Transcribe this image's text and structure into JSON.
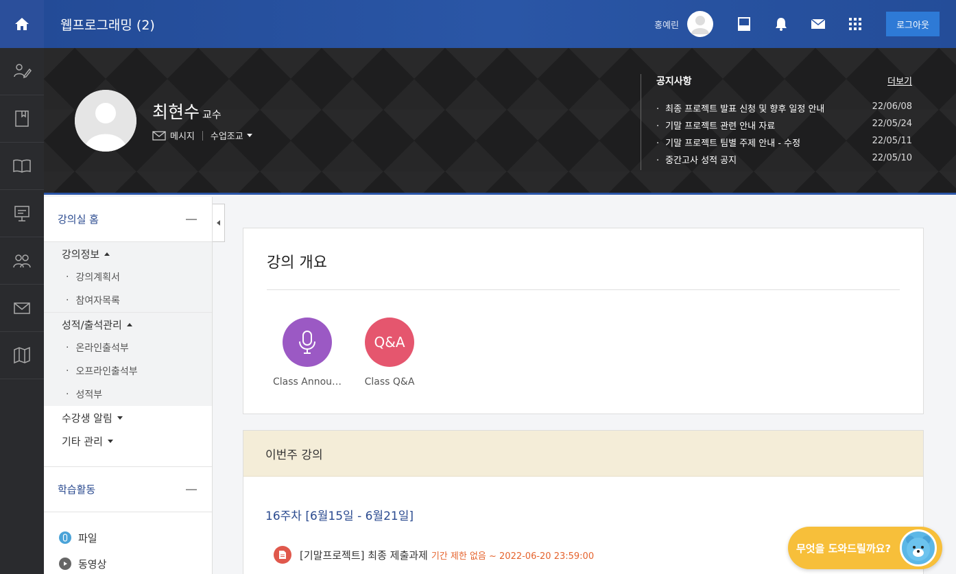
{
  "header": {
    "course_title": "웹프로그래밍 (2)",
    "user_name": "홍예린",
    "logout_label": "로그아웃"
  },
  "rail": {
    "icons": [
      "home-icon",
      "pencil-person-icon",
      "bookmark-book-icon",
      "open-book-icon",
      "presentation-board-icon",
      "people-icon",
      "mail-icon",
      "map-icon"
    ]
  },
  "profile": {
    "name": "최현수",
    "role": "교수",
    "message_label": "메시지",
    "assistant_label": "수업조교"
  },
  "notices": {
    "title": "공지사항",
    "more_label": "더보기",
    "items": [
      {
        "text": "최종 프로젝트 발표 신청 및 향후 일정 안내",
        "date": "22/06/08"
      },
      {
        "text": "기말 프로젝트 관련 안내 자료",
        "date": "22/05/24"
      },
      {
        "text": "기말 프로젝트 팀별 주제 안내 - 수정",
        "date": "22/05/11"
      },
      {
        "text": "중간고사 성적 공지",
        "date": "22/05/10"
      }
    ]
  },
  "sidebar": {
    "home_label": "강의실 홈",
    "groups": [
      {
        "title": "강의정보",
        "items": [
          "강의계획서",
          "참여자목록"
        ]
      },
      {
        "title": "성적/출석관리",
        "items": [
          "온라인출석부",
          "오프라인출석부",
          "성적부"
        ]
      }
    ],
    "plain": [
      "수강생 알림",
      "기타 관리"
    ],
    "activity_label": "학습활동",
    "activities": [
      {
        "label": "파일",
        "color": "#4aa3d8"
      },
      {
        "label": "동영상",
        "color": "#666666"
      }
    ]
  },
  "overview": {
    "title": "강의 개요",
    "modules": [
      {
        "label": "Class Annou…",
        "color": "#9b59c4",
        "icon": "microphone-icon"
      },
      {
        "label": "Class Q&A",
        "color": "#e5566e",
        "text": "Q&A"
      }
    ]
  },
  "this_week": {
    "title": "이번주 강의",
    "week_label": "16주차 [6월15일 - 6월21일]",
    "assignment_title": "[기말프로젝트] 최종 제출과제",
    "assignment_due": "기간 제한 없음 ~ 2022-06-20 23:59:00"
  },
  "chatbot": {
    "label": "무엇을 도와드릴까요?"
  }
}
